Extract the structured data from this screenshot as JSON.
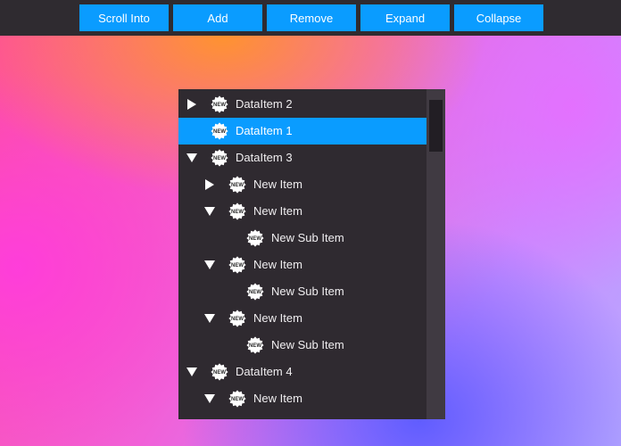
{
  "toolbar": {
    "scroll_into_label": "Scroll Into",
    "add_label": "Add",
    "remove_label": "Remove",
    "expand_label": "Expand",
    "collapse_label": "Collapse"
  },
  "tree": {
    "badge_text": "NEW",
    "rows": [
      {
        "label": "DataItem 2",
        "level": 0,
        "state": "collapsed",
        "selected": false
      },
      {
        "label": "DataItem 1",
        "level": 0,
        "state": "leaf",
        "selected": true
      },
      {
        "label": "DataItem 3",
        "level": 0,
        "state": "expanded",
        "selected": false
      },
      {
        "label": "New Item",
        "level": 1,
        "state": "collapsed",
        "selected": false
      },
      {
        "label": "New Item",
        "level": 1,
        "state": "expanded",
        "selected": false
      },
      {
        "label": "New Sub Item",
        "level": 2,
        "state": "leaf",
        "selected": false
      },
      {
        "label": "New Item",
        "level": 1,
        "state": "expanded",
        "selected": false
      },
      {
        "label": "New Sub Item",
        "level": 2,
        "state": "leaf",
        "selected": false
      },
      {
        "label": "New Item",
        "level": 1,
        "state": "expanded",
        "selected": false
      },
      {
        "label": "New Sub Item",
        "level": 2,
        "state": "leaf",
        "selected": false
      },
      {
        "label": "DataItem 4",
        "level": 0,
        "state": "expanded",
        "selected": false
      },
      {
        "label": "New Item",
        "level": 1,
        "state": "expanded",
        "selected": false
      }
    ]
  },
  "colors": {
    "accent": "#0a9cff",
    "tree_background": "#2f2a30",
    "toolbar_background": "#2f2b30"
  }
}
